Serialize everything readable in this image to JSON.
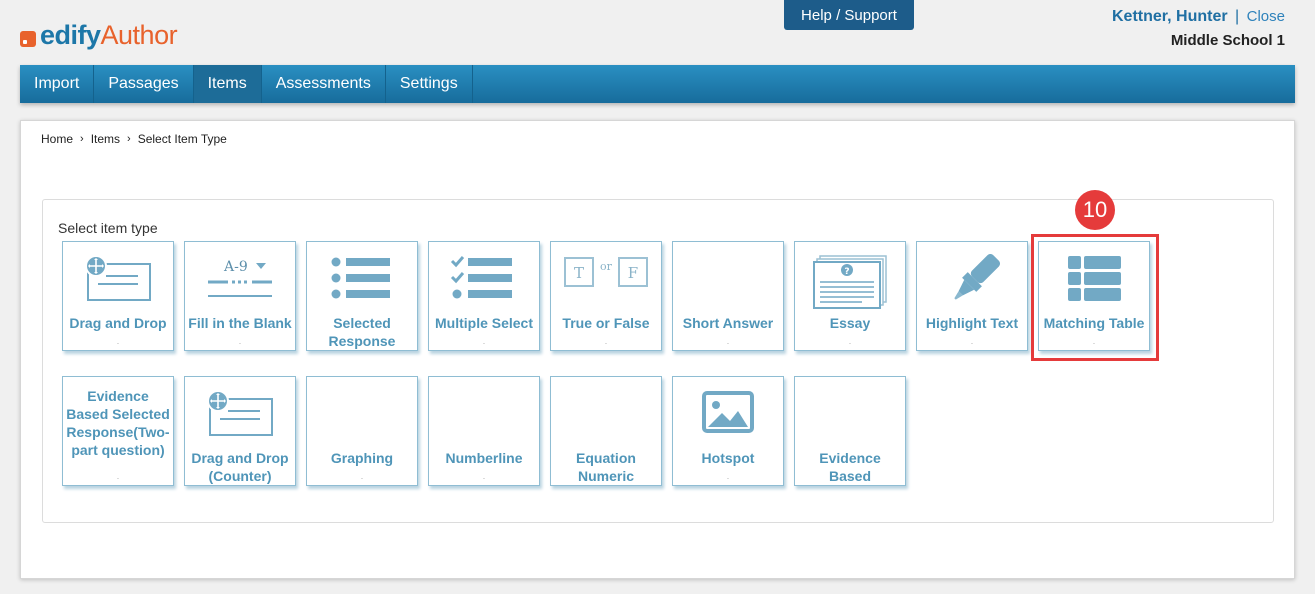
{
  "brand": {
    "edify": "edify",
    "author": "Author",
    "accent": "#e8622c",
    "primary": "#1d77a8"
  },
  "header": {
    "help_label": "Help / Support",
    "user_name": "Kettner, Hunter",
    "separator": "|",
    "close_label": "Close",
    "school": "Middle School 1"
  },
  "nav": {
    "items": [
      {
        "label": "Import"
      },
      {
        "label": "Passages"
      },
      {
        "label": "Items",
        "active": true
      },
      {
        "label": "Assessments"
      },
      {
        "label": "Settings"
      }
    ]
  },
  "breadcrumb": {
    "home": "Home",
    "items": "Items",
    "current": "Select Item Type"
  },
  "item_types": {
    "heading": "Select item type",
    "row1": [
      {
        "label": "Drag and Drop",
        "icon": "drag-and-drop-icon"
      },
      {
        "label": "Fill in the Blank",
        "icon": "fill-in-blank-icon",
        "icon_text": "A-9"
      },
      {
        "label": "Selected Response",
        "icon": "list-icon"
      },
      {
        "label": "Multiple Select",
        "icon": "checklist-icon"
      },
      {
        "label": "True or False",
        "icon": "true-false-icon",
        "t": "T",
        "or": "or",
        "f": "F"
      },
      {
        "label": "Short Answer",
        "icon": ""
      },
      {
        "label": "Essay",
        "icon": "essay-icon",
        "mark": "?"
      },
      {
        "label": "Highlight Text",
        "icon": "highlighter-icon"
      },
      {
        "label": "Matching Table",
        "icon": "table-icon"
      }
    ],
    "row2": [
      {
        "label": "Evidence Based Selected Response(Two-part question)",
        "icon": ""
      },
      {
        "label": "Drag and Drop (Counter)",
        "icon": "drag-and-drop-icon"
      },
      {
        "label": "Graphing",
        "icon": ""
      },
      {
        "label": "Numberline",
        "icon": ""
      },
      {
        "label": "Equation Numeric",
        "icon": ""
      },
      {
        "label": "Hotspot",
        "icon": "image-icon"
      },
      {
        "label": "Evidence Based",
        "icon": ""
      }
    ]
  },
  "annotation": {
    "step": "10",
    "color": "#e53b3b"
  },
  "tile_dot": "."
}
